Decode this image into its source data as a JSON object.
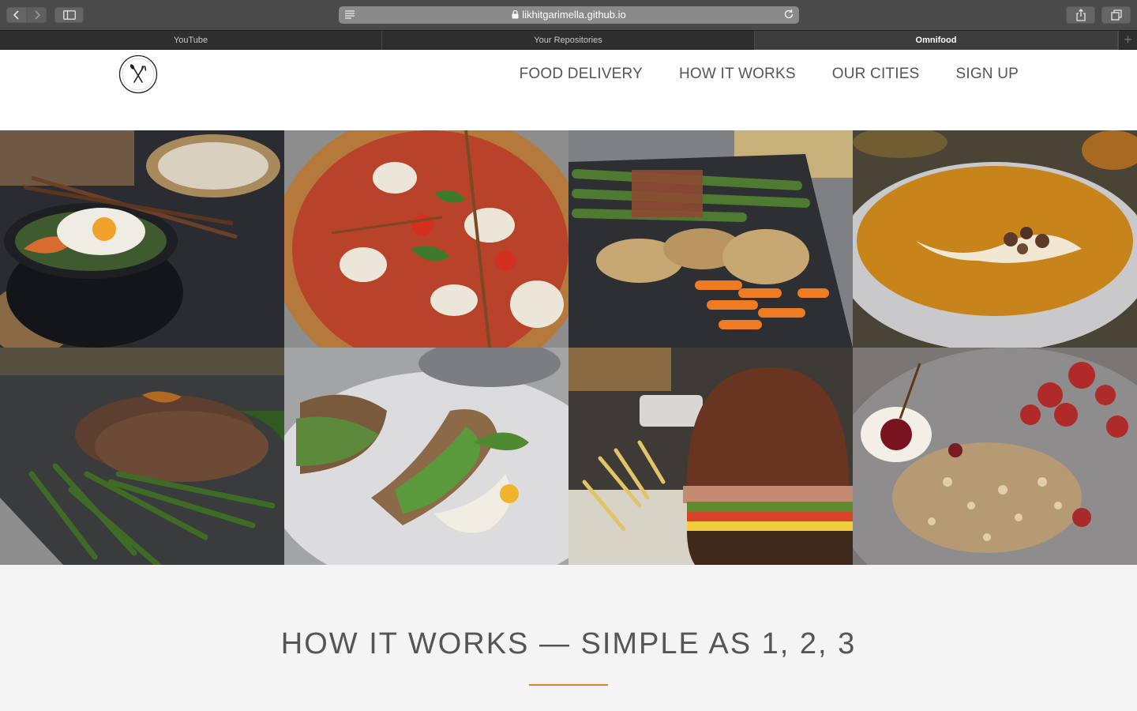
{
  "browser": {
    "url": "likhitgarimella.github.io",
    "tabs": [
      {
        "label": "YouTube",
        "active": false
      },
      {
        "label": "Your Repositories",
        "active": false
      },
      {
        "label": "Omnifood",
        "active": true
      }
    ],
    "new_tab_symbol": "+"
  },
  "site": {
    "nav": [
      "FOOD DELIVERY",
      "HOW IT WORKS",
      "OUR CITIES",
      "SIGN UP"
    ],
    "section_title": "HOW IT WORKS — SIMPLE AS 1, 2, 3",
    "accent_color": "#e67e22"
  },
  "gallery": [
    {
      "name": "bibimbap-photo"
    },
    {
      "name": "pizza-photo"
    },
    {
      "name": "asparagus-chicken-photo"
    },
    {
      "name": "pumpkin-soup-photo"
    },
    {
      "name": "steak-beans-photo"
    },
    {
      "name": "sandwich-photo"
    },
    {
      "name": "burger-photo"
    },
    {
      "name": "granola-berries-photo"
    }
  ]
}
